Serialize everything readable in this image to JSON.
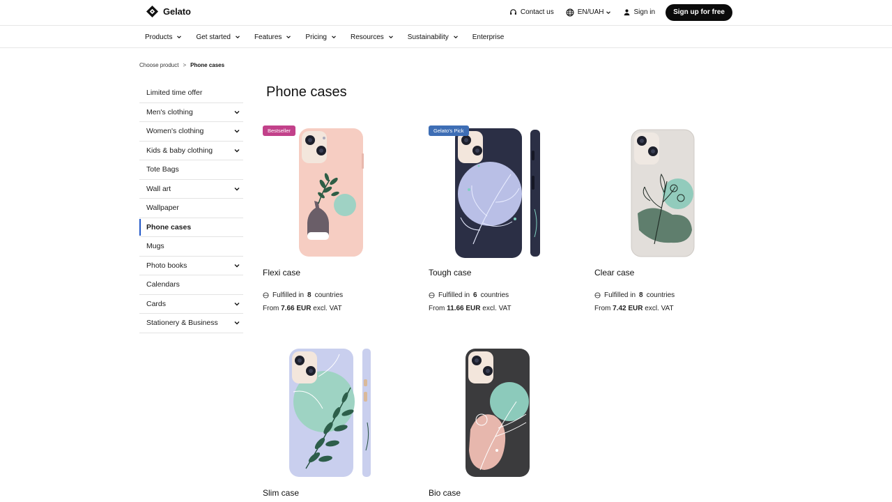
{
  "header": {
    "brand": "Gelato",
    "contact": "Contact us",
    "language": "EN/UAH",
    "signin": "Sign in",
    "signup": "Sign up for free"
  },
  "nav": {
    "items": [
      {
        "label": "Products"
      },
      {
        "label": "Get started"
      },
      {
        "label": "Features"
      },
      {
        "label": "Pricing"
      },
      {
        "label": "Resources"
      },
      {
        "label": "Sustainability"
      },
      {
        "label": "Enterprise"
      }
    ]
  },
  "breadcrumb": {
    "parent": "Choose product",
    "separator": ">",
    "current": "Phone cases"
  },
  "sidebar": {
    "items": [
      {
        "label": "Limited time offer"
      },
      {
        "label": "Men's clothing"
      },
      {
        "label": "Women's clothing"
      },
      {
        "label": "Kids & baby clothing"
      },
      {
        "label": "Tote Bags"
      },
      {
        "label": "Wall art"
      },
      {
        "label": "Wallpaper"
      },
      {
        "label": "Phone cases"
      },
      {
        "label": "Mugs"
      },
      {
        "label": "Photo books"
      },
      {
        "label": "Calendars"
      },
      {
        "label": "Cards"
      },
      {
        "label": "Stationery & Business"
      }
    ],
    "active": "Phone cases"
  },
  "main": {
    "title": "Phone cases",
    "products": [
      {
        "name": "Flexi case",
        "badge": "Bestseller",
        "fulfilled_prefix": "Fulfilled in",
        "countries": "8",
        "fulfilled_suffix": "countries",
        "price_prefix": "From",
        "price": "7.66 EUR",
        "price_suffix": "excl. VAT"
      },
      {
        "name": "Tough case",
        "badge": "Gelato's Pick",
        "fulfilled_prefix": "Fulfilled in",
        "countries": "6",
        "fulfilled_suffix": "countries",
        "price_prefix": "From",
        "price": "11.66 EUR",
        "price_suffix": "excl. VAT"
      },
      {
        "name": "Clear case",
        "fulfilled_prefix": "Fulfilled in",
        "countries": "8",
        "fulfilled_suffix": "countries",
        "price_prefix": "From",
        "price": "7.42 EUR",
        "price_suffix": "excl. VAT"
      },
      {
        "name": "Slim case"
      },
      {
        "name": "Bio case"
      }
    ]
  },
  "colors": {
    "accent": "#2157c7",
    "badge_bestseller": "#c2418a",
    "badge_pick": "#3e6eb5",
    "signup_bg": "#0b0b0b"
  }
}
